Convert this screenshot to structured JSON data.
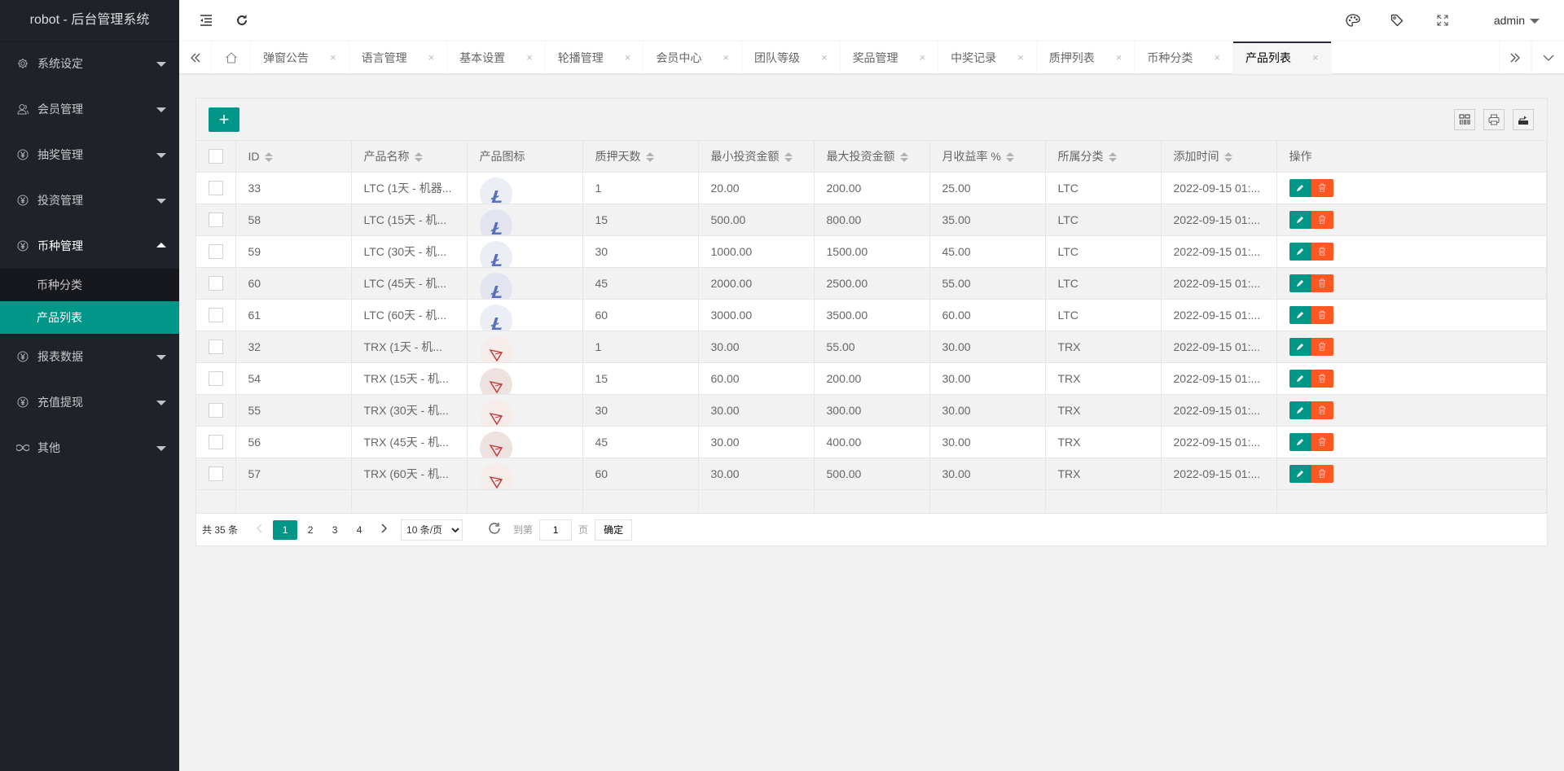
{
  "app": {
    "title": "robot - 后台管理系统"
  },
  "sidebar": {
    "items": [
      {
        "label": "系统设定",
        "icon": "gear-icon"
      },
      {
        "label": "会员管理",
        "icon": "user-icon"
      },
      {
        "label": "抽奖管理",
        "icon": "yen-circle-icon"
      },
      {
        "label": "投资管理",
        "icon": "yen-circle-icon"
      },
      {
        "label": "币种管理",
        "icon": "yen-circle-icon",
        "open": true,
        "children": [
          {
            "label": "币种分类"
          },
          {
            "label": "产品列表",
            "active": true
          }
        ]
      },
      {
        "label": "报表数据",
        "icon": "yen-circle-icon"
      },
      {
        "label": "充值提现",
        "icon": "yen-circle-icon"
      },
      {
        "label": "其他",
        "icon": "infinity-icon"
      }
    ]
  },
  "header": {
    "user": "admin",
    "icons": [
      "menu-collapse-icon",
      "refresh-icon",
      "palette-icon",
      "tag-icon",
      "fullscreen-icon"
    ]
  },
  "tabs": {
    "items": [
      {
        "label": "弹窗公告"
      },
      {
        "label": "语言管理"
      },
      {
        "label": "基本设置"
      },
      {
        "label": "轮播管理"
      },
      {
        "label": "会员中心"
      },
      {
        "label": "团队等级"
      },
      {
        "label": "奖品管理"
      },
      {
        "label": "中奖记录"
      },
      {
        "label": "质押列表"
      },
      {
        "label": "币种分类"
      },
      {
        "label": "产品列表",
        "active": true
      }
    ],
    "close_glyph": "×"
  },
  "toolbar": {
    "add_label": "+"
  },
  "table": {
    "columns": [
      "ID",
      "产品名称",
      "产品图标",
      "质押天数",
      "最小投资金额",
      "最大投资金额",
      "月收益率 %",
      "所属分类",
      "添加时间",
      "操作"
    ],
    "rows": [
      {
        "id": "33",
        "name": "LTC (1天 - 机器...",
        "coin": "LTC",
        "days": "1",
        "min": "20.00",
        "max": "200.00",
        "rate": "25.00",
        "category": "LTC",
        "time": "2022-09-15 01:..."
      },
      {
        "id": "58",
        "name": "LTC (15天 - 机...",
        "coin": "LTC",
        "days": "15",
        "min": "500.00",
        "max": "800.00",
        "rate": "35.00",
        "category": "LTC",
        "time": "2022-09-15 01:..."
      },
      {
        "id": "59",
        "name": "LTC (30天 - 机...",
        "coin": "LTC",
        "days": "30",
        "min": "1000.00",
        "max": "1500.00",
        "rate": "45.00",
        "category": "LTC",
        "time": "2022-09-15 01:..."
      },
      {
        "id": "60",
        "name": "LTC (45天 - 机...",
        "coin": "LTC",
        "days": "45",
        "min": "2000.00",
        "max": "2500.00",
        "rate": "55.00",
        "category": "LTC",
        "time": "2022-09-15 01:..."
      },
      {
        "id": "61",
        "name": "LTC (60天 - 机...",
        "coin": "LTC",
        "days": "60",
        "min": "3000.00",
        "max": "3500.00",
        "rate": "60.00",
        "category": "LTC",
        "time": "2022-09-15 01:..."
      },
      {
        "id": "32",
        "name": "TRX (1天 - 机...",
        "coin": "TRX",
        "days": "1",
        "min": "30.00",
        "max": "55.00",
        "rate": "30.00",
        "category": "TRX",
        "time": "2022-09-15 01:..."
      },
      {
        "id": "54",
        "name": "TRX (15天 - 机...",
        "coin": "TRX",
        "days": "15",
        "min": "60.00",
        "max": "200.00",
        "rate": "30.00",
        "category": "TRX",
        "time": "2022-09-15 01:..."
      },
      {
        "id": "55",
        "name": "TRX (30天 - 机...",
        "coin": "TRX",
        "days": "30",
        "min": "30.00",
        "max": "300.00",
        "rate": "30.00",
        "category": "TRX",
        "time": "2022-09-15 01:..."
      },
      {
        "id": "56",
        "name": "TRX (45天 - 机...",
        "coin": "TRX",
        "days": "45",
        "min": "30.00",
        "max": "400.00",
        "rate": "30.00",
        "category": "TRX",
        "time": "2022-09-15 01:..."
      },
      {
        "id": "57",
        "name": "TRX (60天 - 机...",
        "coin": "TRX",
        "days": "60",
        "min": "30.00",
        "max": "500.00",
        "rate": "30.00",
        "category": "TRX",
        "time": "2022-09-15 01:..."
      }
    ]
  },
  "pager": {
    "total": "共 35 条",
    "pages": [
      "1",
      "2",
      "3",
      "4"
    ],
    "current": "1",
    "per_page": "10 条/页",
    "goto_label": "到第",
    "goto_value": "1",
    "page_unit": "页",
    "confirm": "确定"
  },
  "colors": {
    "accent": "#009688",
    "danger": "#ff5722",
    "sidebar": "#20222a",
    "ltc": "#5a6fb8",
    "trx": "#c0393b"
  }
}
